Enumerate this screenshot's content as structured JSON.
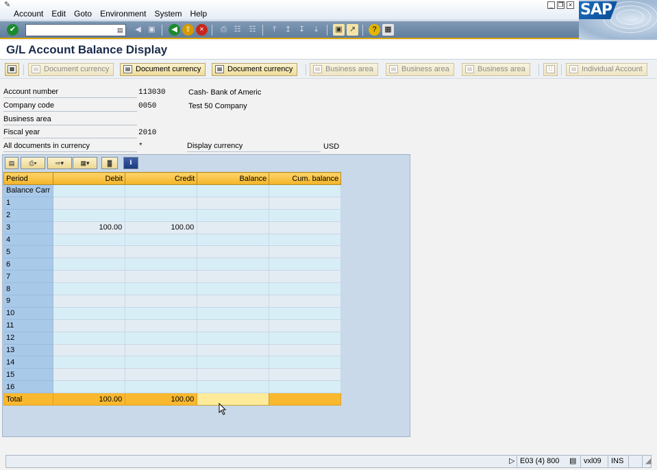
{
  "menubar": {
    "items": [
      "Account",
      "Edit",
      "Goto",
      "Environment",
      "System",
      "Help"
    ]
  },
  "logo": {
    "text": "SAP"
  },
  "toolbar": {
    "command_value": ""
  },
  "page": {
    "title": "G/L Account Balance Display"
  },
  "app_toolbar": {
    "buttons": [
      {
        "label": "Document currency",
        "enabled": false
      },
      {
        "label": "Document currency",
        "enabled": true
      },
      {
        "label": "Document currency",
        "enabled": true
      },
      {
        "label": "Business area",
        "enabled": false
      },
      {
        "label": "Business area",
        "enabled": false
      },
      {
        "label": "Business area",
        "enabled": false
      },
      {
        "label": "Individual Account",
        "enabled": false
      }
    ]
  },
  "header": {
    "account_number": {
      "label": "Account number",
      "value": "113030",
      "desc": "Cash- Bank of Americ"
    },
    "company_code": {
      "label": "Company code",
      "value": "0050",
      "desc": "Test 50 Company"
    },
    "business_area": {
      "label": "Business area",
      "value": ""
    },
    "fiscal_year": {
      "label": "Fiscal year",
      "value": "2010"
    },
    "all_docs_currency": {
      "label": "All documents in currency",
      "value": "*"
    },
    "display_currency": {
      "label": "Display currency",
      "value": "USD"
    }
  },
  "grid": {
    "columns": [
      "Period",
      "Debit",
      "Credit",
      "Balance",
      "Cum. balance"
    ],
    "rows": [
      {
        "period": "Balance Carr",
        "debit": "",
        "credit": "",
        "balance": "",
        "cum": ""
      },
      {
        "period": "1",
        "debit": "",
        "credit": "",
        "balance": "",
        "cum": ""
      },
      {
        "period": "2",
        "debit": "",
        "credit": "",
        "balance": "",
        "cum": ""
      },
      {
        "period": "3",
        "debit": "100.00",
        "credit": "100.00",
        "balance": "",
        "cum": ""
      },
      {
        "period": "4",
        "debit": "",
        "credit": "",
        "balance": "",
        "cum": ""
      },
      {
        "period": "5",
        "debit": "",
        "credit": "",
        "balance": "",
        "cum": ""
      },
      {
        "period": "6",
        "debit": "",
        "credit": "",
        "balance": "",
        "cum": ""
      },
      {
        "period": "7",
        "debit": "",
        "credit": "",
        "balance": "",
        "cum": ""
      },
      {
        "period": "8",
        "debit": "",
        "credit": "",
        "balance": "",
        "cum": ""
      },
      {
        "period": "9",
        "debit": "",
        "credit": "",
        "balance": "",
        "cum": ""
      },
      {
        "period": "10",
        "debit": "",
        "credit": "",
        "balance": "",
        "cum": ""
      },
      {
        "period": "11",
        "debit": "",
        "credit": "",
        "balance": "",
        "cum": ""
      },
      {
        "period": "12",
        "debit": "",
        "credit": "",
        "balance": "",
        "cum": ""
      },
      {
        "period": "13",
        "debit": "",
        "credit": "",
        "balance": "",
        "cum": ""
      },
      {
        "period": "14",
        "debit": "",
        "credit": "",
        "balance": "",
        "cum": ""
      },
      {
        "period": "15",
        "debit": "",
        "credit": "",
        "balance": "",
        "cum": ""
      },
      {
        "period": "16",
        "debit": "",
        "credit": "",
        "balance": "",
        "cum": ""
      }
    ],
    "total": {
      "period": "Total",
      "debit": "100.00",
      "credit": "100.00",
      "balance": "",
      "cum": ""
    }
  },
  "statusbar": {
    "session": "E03 (4) 800",
    "server": "vxl09",
    "mode": "INS"
  },
  "colors": {
    "accent": "#d9a200",
    "header_yellow": "#f3b427",
    "period_blue": "#a9c9e9"
  }
}
